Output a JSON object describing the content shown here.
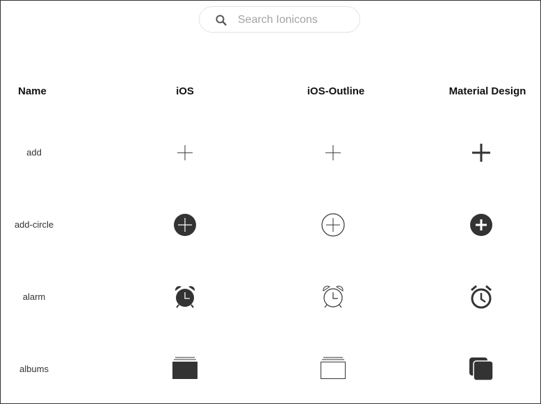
{
  "search": {
    "placeholder": "Search Ionicons",
    "icon": "search-icon"
  },
  "columns": {
    "name": "Name",
    "ios": "iOS",
    "ios_outline": "iOS-Outline",
    "material": "Material Design"
  },
  "rows": [
    {
      "name": "add",
      "icons": {
        "ios": "add-ios-icon",
        "ios_outline": "add-outline-icon",
        "material": "add-md-icon"
      }
    },
    {
      "name": "add-circle",
      "icons": {
        "ios": "add-circle-ios-icon",
        "ios_outline": "add-circle-outline-icon",
        "material": "add-circle-md-icon"
      }
    },
    {
      "name": "alarm",
      "icons": {
        "ios": "alarm-ios-icon",
        "ios_outline": "alarm-outline-icon",
        "material": "alarm-md-icon"
      }
    },
    {
      "name": "albums",
      "icons": {
        "ios": "albums-ios-icon",
        "ios_outline": "albums-outline-icon",
        "material": "albums-md-icon"
      }
    }
  ],
  "colors": {
    "icon": "#333333",
    "placeholder": "#a3a3a3",
    "search_border": "#e3e3e3"
  }
}
